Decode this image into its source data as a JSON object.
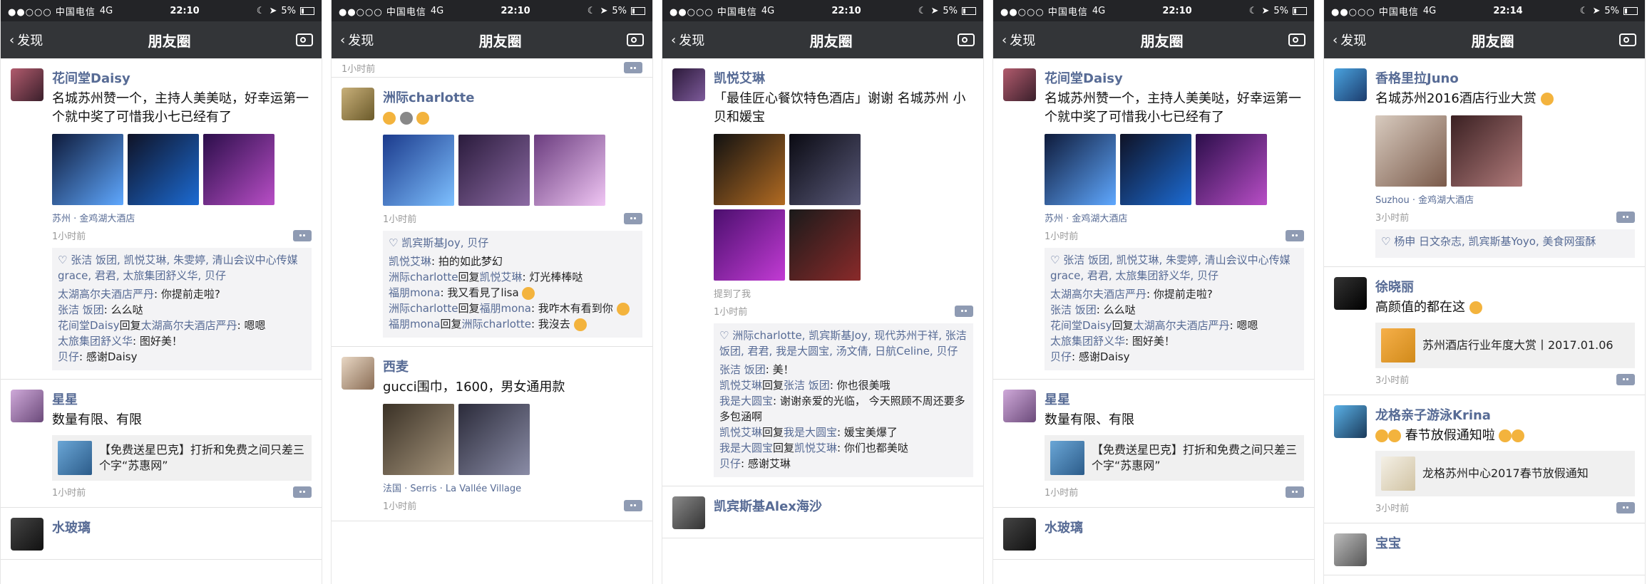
{
  "common": {
    "carrier": "●●○○○ 中国电信",
    "network": "4G",
    "battery": "5%",
    "back_label": "发现",
    "title": "朋友圈"
  },
  "panels": [
    {
      "time": "22:10",
      "posts": [
        {
          "name": "花间堂Daisy",
          "text": "名城苏州赞一个，主持人美美哒，好幸运第一个就中奖了可惜我小七已经有了",
          "location": "苏州 · 金鸡湖大酒店",
          "time": "1小时前",
          "likes": "张洁 饭团, 凯悦艾琳, 朱雯婷, 清山会议中心传媒grace, 君君, 太旅集团舒义华, 贝仔",
          "comments": [
            {
              "name": "太湖高尔夫酒店严丹",
              "text": "你提前走啦?"
            },
            {
              "name": "张洁 饭团",
              "text": "么么哒"
            },
            {
              "name": "花间堂Daisy",
              "reply": "太湖高尔夫酒店严丹",
              "text": "嗯嗯"
            },
            {
              "name": "太旅集团舒义华",
              "text": "图好美！"
            },
            {
              "name": "贝仔",
              "text": "感谢Daisy"
            }
          ]
        },
        {
          "name": "星星",
          "text": "数量有限、有限",
          "link_text": "【免费送星巴克】打折和免费之间只差三个字“苏惠网”",
          "time": "1小时前"
        },
        {
          "name": "水玻璃"
        }
      ]
    },
    {
      "time": "22:10",
      "top_time": "1小时前",
      "posts": [
        {
          "name": "洲际charlotte",
          "time": "1小时前",
          "likes": "凯宾斯基Joy, 贝仔",
          "comments": [
            {
              "name": "凯悦艾琳",
              "text": "拍的如此梦幻"
            },
            {
              "name": "洲际charlotte",
              "reply": "凯悦艾琳",
              "text": "灯光棒棒哒"
            },
            {
              "name": "福朋mona",
              "text": "我又看見了lisa"
            },
            {
              "name": "洲际charlotte",
              "reply": "福朋mona",
              "text": "我咋木有看到你"
            },
            {
              "name": "福朋mona",
              "reply": "洲际charlotte",
              "text": "我沒去"
            }
          ]
        },
        {
          "name": "西麦",
          "text": "gucci围巾，1600，男女通用款",
          "location": "法国 · Serris · La Vallée Village",
          "time": "1小时前"
        }
      ]
    },
    {
      "time": "22:10",
      "posts": [
        {
          "name": "凯悦艾琳",
          "text": "「最佳匠心餐饮特色酒店」谢谢 名城苏州 小贝和媛宝",
          "mention": "提到了我",
          "time": "1小时前",
          "likes": "洲际charlotte, 凯宾斯基Joy, 现代苏州于祥, 张洁 饭团, 君君, 我是大圆宝, 汤文倩, 日航Celine, 贝仔",
          "comments": [
            {
              "name": "张洁 饭团",
              "text": "美！"
            },
            {
              "name": "凯悦艾琳",
              "reply": "张洁 饭团",
              "text": "你也很美哦"
            },
            {
              "name": "我是大圆宝",
              "text": "谢谢亲爱的光临， 今天照顾不周还要多多包涵啊"
            },
            {
              "name": "凯悦艾琳",
              "reply": "我是大圆宝",
              "text": "媛宝美爆了"
            },
            {
              "name": "我是大圆宝",
              "reply": "凯悦艾琳",
              "text": "你们也都美哒"
            },
            {
              "name": "贝仔",
              "text": "感谢艾琳"
            }
          ]
        },
        {
          "name": "凯宾斯基Alex海沙"
        }
      ]
    },
    {
      "time": "22:10",
      "posts": [
        {
          "name": "花间堂Daisy",
          "text": "名城苏州赞一个，主持人美美哒，好幸运第一个就中奖了可惜我小七已经有了",
          "location": "苏州 · 金鸡湖大酒店",
          "time": "1小时前",
          "likes": "张洁 饭团, 凯悦艾琳, 朱雯婷, 清山会议中心传媒grace, 君君, 太旅集团舒义华, 贝仔",
          "comments": [
            {
              "name": "太湖高尔夫酒店严丹",
              "text": "你提前走啦?"
            },
            {
              "name": "张洁 饭团",
              "text": "么么哒"
            },
            {
              "name": "花间堂Daisy",
              "reply": "太湖高尔夫酒店严丹",
              "text": "嗯嗯"
            },
            {
              "name": "太旅集团舒义华",
              "text": "图好美！"
            },
            {
              "name": "贝仔",
              "text": "感谢Daisy"
            }
          ]
        },
        {
          "name": "星星",
          "text": "数量有限、有限",
          "link_text": "【免费送星巴克】打折和免费之间只差三个字“苏惠网”",
          "time": "1小时前"
        },
        {
          "name": "水玻璃"
        }
      ]
    },
    {
      "time": "22:14",
      "posts": [
        {
          "name": "香格里拉Juno",
          "text": "名城苏州2016酒店行业大赏",
          "location": "Suzhou · 金鸡湖大酒店",
          "time": "3小时前",
          "likes": "杨申 日文杂志, 凯宾斯基Yoyo, 美食网蛋酥"
        },
        {
          "name": "徐晓丽",
          "text": "高颜值的都在这",
          "link_text": "苏州酒店行业年度大赏丨2017.01.06",
          "time": "3小时前"
        },
        {
          "name": "龙格亲子游泳Krina",
          "text": "春节放假通知啦",
          "link_text": "龙格苏州中心2017春节放假通知",
          "time": "3小时前"
        },
        {
          "name": "宝宝"
        }
      ]
    }
  ]
}
